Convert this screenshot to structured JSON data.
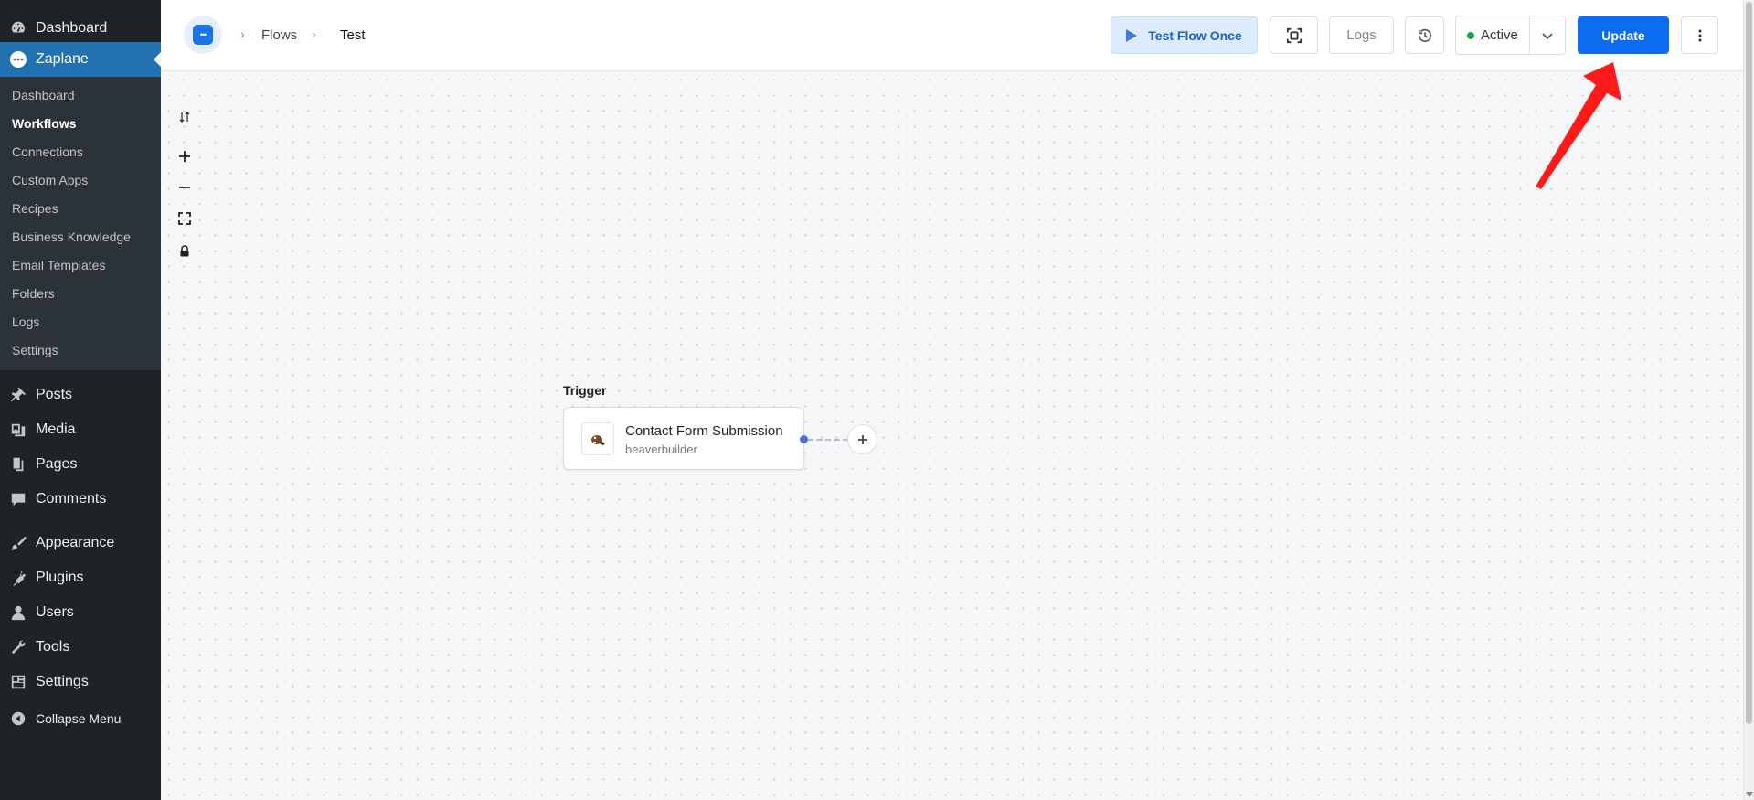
{
  "sidebar": {
    "top": [
      {
        "label": "Dashboard",
        "icon": "dashboard-icon"
      },
      {
        "label": "Zaplane",
        "icon": "zaplane-icon",
        "current": true
      }
    ],
    "submenu": [
      {
        "label": "Dashboard"
      },
      {
        "label": "Workflows",
        "active": true
      },
      {
        "label": "Connections"
      },
      {
        "label": "Custom Apps"
      },
      {
        "label": "Recipes"
      },
      {
        "label": "Business Knowledge"
      },
      {
        "label": "Email Templates"
      },
      {
        "label": "Folders"
      },
      {
        "label": "Logs"
      },
      {
        "label": "Settings"
      }
    ],
    "bottom": [
      {
        "label": "Posts",
        "icon": "pin-icon"
      },
      {
        "label": "Media",
        "icon": "media-icon"
      },
      {
        "label": "Pages",
        "icon": "pages-icon"
      },
      {
        "label": "Comments",
        "icon": "comment-icon"
      },
      {
        "label": "Appearance",
        "icon": "brush-icon"
      },
      {
        "label": "Plugins",
        "icon": "plug-icon"
      },
      {
        "label": "Users",
        "icon": "user-icon"
      },
      {
        "label": "Tools",
        "icon": "wrench-icon"
      },
      {
        "label": "Settings",
        "icon": "settings-icon"
      },
      {
        "label": "Collapse Menu",
        "icon": "collapse-icon"
      }
    ]
  },
  "header": {
    "breadcrumb": [
      "Flows",
      "Test"
    ],
    "test_label": "Test Flow Once",
    "logs_label": "Logs",
    "status_label": "Active",
    "update_label": "Update"
  },
  "canvas": {
    "node_section_label": "Trigger",
    "node": {
      "title": "Contact Form Submission",
      "subtitle": "beaverbuilder"
    }
  },
  "colors": {
    "primary": "#0b6cf0",
    "sidebar_bg": "#1d2327",
    "sidebar_active": "#2271b1",
    "status_active": "#16a34a",
    "annotation": "#ff1a1a"
  }
}
